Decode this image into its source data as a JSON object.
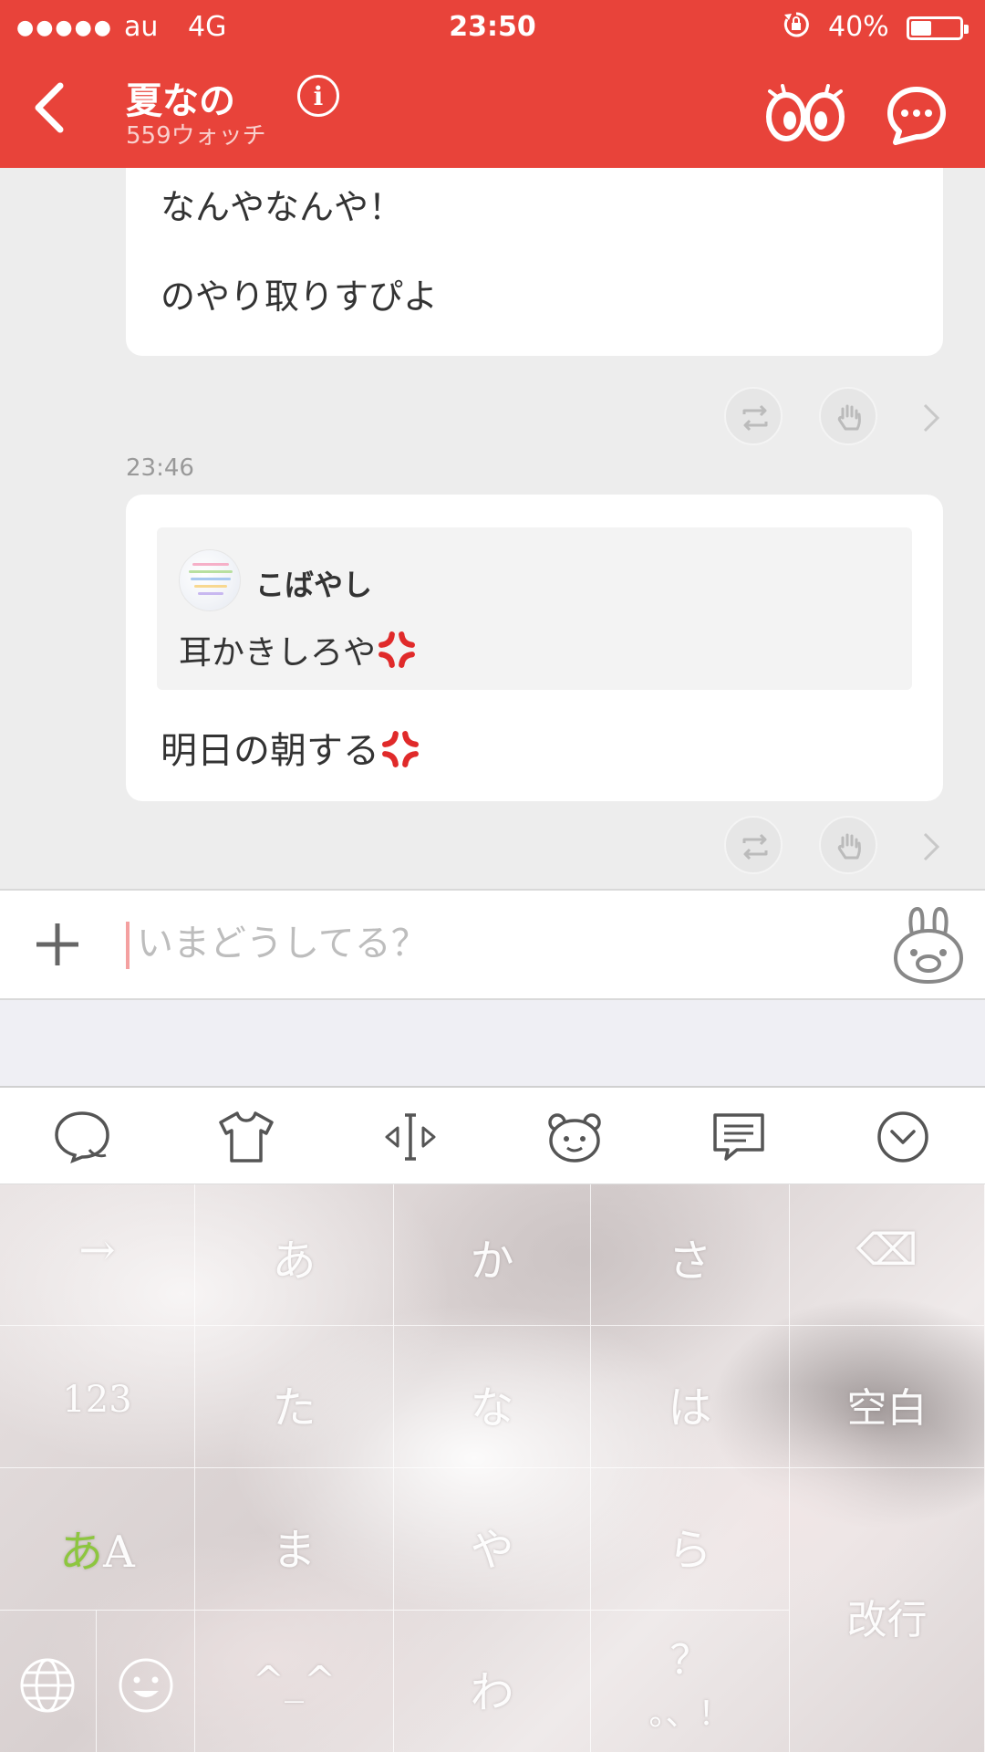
{
  "status_bar": {
    "signal_dots": "●●●●●",
    "carrier": "au",
    "network": "4G",
    "time": "23:50",
    "battery": "40%"
  },
  "header": {
    "title": "夏なの",
    "subtitle": "559ウォッチ",
    "info_icon_glyph": "i"
  },
  "chat": {
    "messages": [
      {
        "lines": [
          "なんやなんや！",
          "のやり取りすぴよ"
        ]
      },
      {
        "timestamp": "23:46",
        "quote": {
          "author": "こばやし",
          "text": "耳かきしろや"
        },
        "text": "明日の朝する"
      }
    ]
  },
  "composer": {
    "placeholder": "いまどうしてる？"
  },
  "keyboard": {
    "toolbar_icons": [
      "speech-bubble-icon",
      "tshirt-icon",
      "cursor-move-icon",
      "bear-face-icon",
      "message-icon",
      "collapse-icon"
    ],
    "keys": {
      "r1": [
        "→",
        "あ",
        "か",
        "さ",
        "⌫"
      ],
      "r2": [
        "123",
        "た",
        "な",
        "は",
        "空白"
      ],
      "r3_mode": {
        "a": "あ",
        "b": "A"
      },
      "r3": [
        "ま",
        "や",
        "ら"
      ],
      "r4": [
        "^_^",
        "わ"
      ],
      "punct_top": "？",
      "punct_bottom": "。、！",
      "enter": "改行"
    }
  },
  "colors": {
    "header_red": "#e8433a",
    "chat_bg": "#ededed",
    "mode_green": "#8dc63f"
  }
}
